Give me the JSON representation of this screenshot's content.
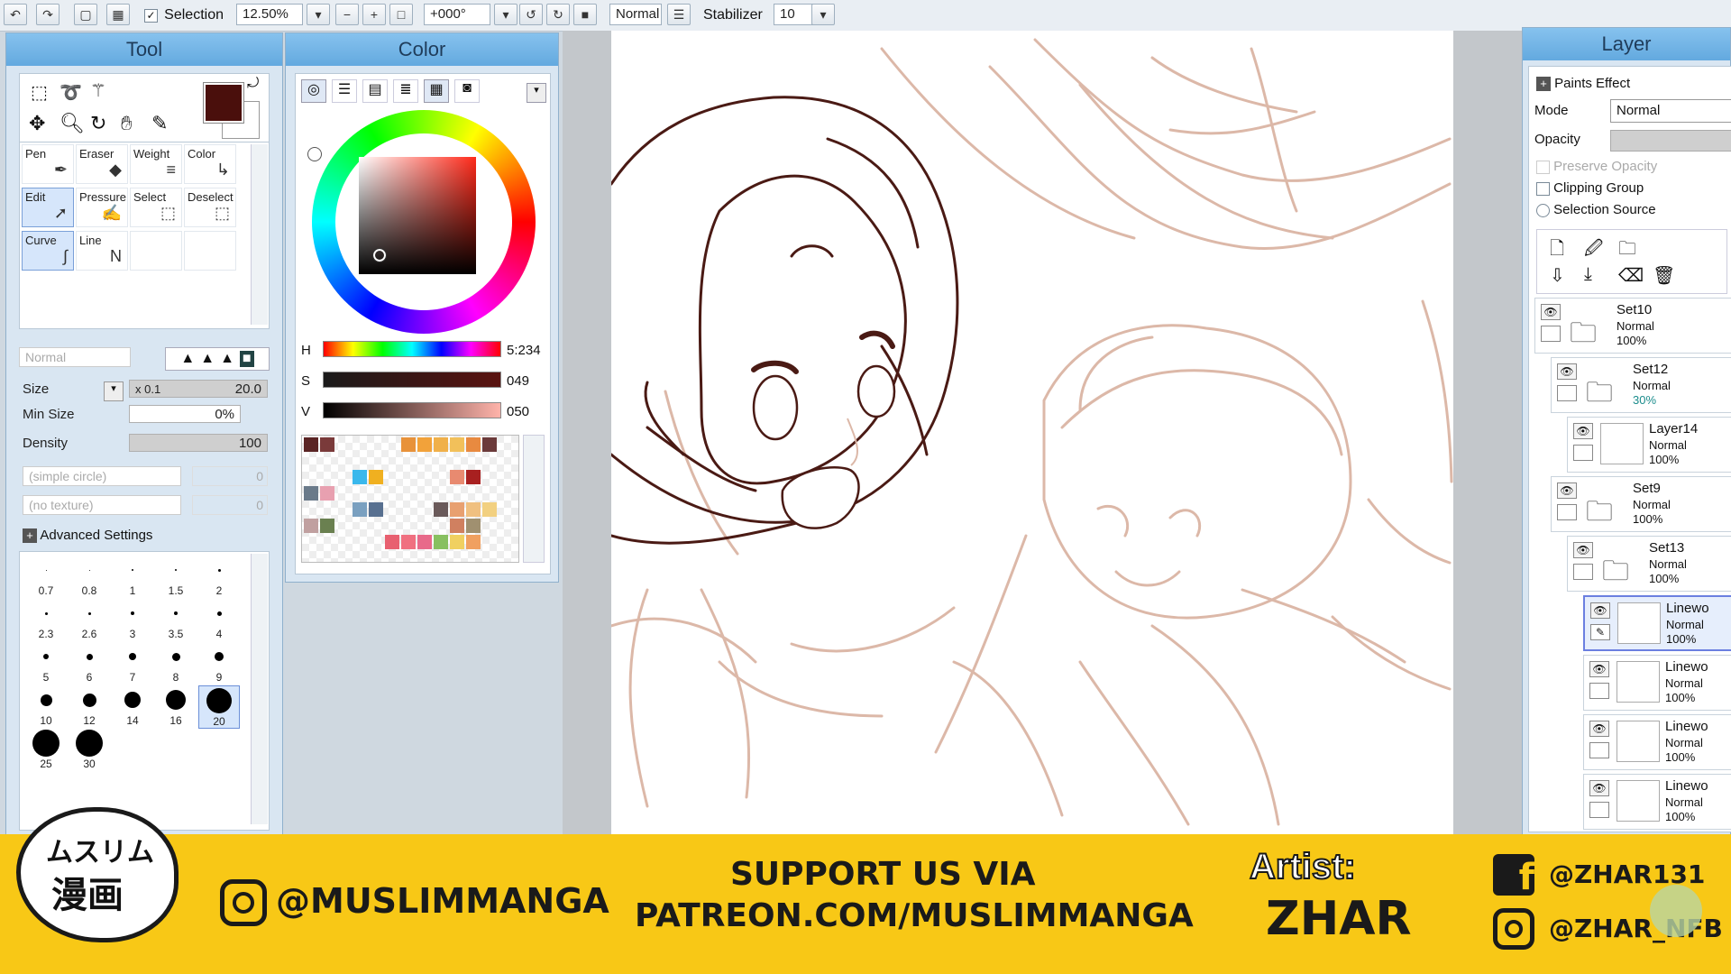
{
  "toolbar": {
    "selection_label": "Selection",
    "zoom": "12.50%",
    "rotation": "+000°",
    "blend_mode": "Normal",
    "stabilizer_label": "Stabilizer",
    "stabilizer_value": "10"
  },
  "tool_panel": {
    "title": "Tool",
    "tools": [
      {
        "label": "Pen"
      },
      {
        "label": "Eraser"
      },
      {
        "label": "Weight"
      },
      {
        "label": "Color"
      },
      {
        "label": "Edit"
      },
      {
        "label": "Pressure"
      },
      {
        "label": "Select"
      },
      {
        "label": "Deselect"
      },
      {
        "label": "Curve"
      },
      {
        "label": "Line"
      }
    ],
    "blend_mode": "Normal",
    "size_label": "Size",
    "size_mult": "x 0.1",
    "size_value": "20.0",
    "min_size_label": "Min Size",
    "min_size_value": "0%",
    "density_label": "Density",
    "density_value": "100",
    "shape_option": "(simple circle)",
    "shape_value": "0",
    "texture_option": "(no texture)",
    "texture_value": "0",
    "advanced_label": "Advanced Settings",
    "brush_sizes": [
      "0.7",
      "0.8",
      "1",
      "1.5",
      "2",
      "2.3",
      "2.6",
      "3",
      "3.5",
      "4",
      "5",
      "6",
      "7",
      "8",
      "9",
      "10",
      "12",
      "14",
      "16",
      "20",
      "25",
      "30"
    ],
    "selected_brush_size": "20"
  },
  "color_panel": {
    "title": "Color",
    "h_label": "H",
    "h_value": "5:234",
    "s_label": "S",
    "s_value": "049",
    "v_label": "V",
    "v_value": "050",
    "current_color": "#4a0f0c",
    "palette_colors": [
      "#5a2424",
      "#7a3a3a",
      "#e8923a",
      "#f2a23a",
      "#f0b04a",
      "#f2c05a",
      "#e88a40",
      "#6b3a3a",
      "#3ab8ec",
      "#f0b020",
      "#e88a70",
      "#a82020",
      "#6a7a8a",
      "#e8a0b0",
      "#7aa0c0",
      "#587090",
      "#6a5a5a",
      "#e8a070",
      "#f0c080",
      "#c0a0a0",
      "#6a8050",
      "#f2d080",
      "#d08060",
      "#a09070",
      "#e86070",
      "#f07080",
      "#e86a8a",
      "#88c060",
      "#f0d060",
      "#f0a060"
    ]
  },
  "layer_panel": {
    "title": "Layer",
    "paints_effect": "Paints Effect",
    "mode_label": "Mode",
    "mode_value": "Normal",
    "opacity_label": "Opacity",
    "preserve_opacity": "Preserve Opacity",
    "clipping_group": "Clipping Group",
    "selection_source": "Selection Source",
    "layers": [
      {
        "name": "Set10",
        "mode": "Normal",
        "opacity": "100%"
      },
      {
        "name": "Set12",
        "mode": "Normal",
        "opacity": "30%"
      },
      {
        "name": "Layer14",
        "mode": "Normal",
        "opacity": "100%"
      },
      {
        "name": "Set9",
        "mode": "Normal",
        "opacity": "100%"
      },
      {
        "name": "Set13",
        "mode": "Normal",
        "opacity": "100%"
      },
      {
        "name": "Linewo",
        "mode": "Normal",
        "opacity": "100%"
      },
      {
        "name": "Linewo",
        "mode": "Normal",
        "opacity": "100%"
      },
      {
        "name": "Linewo",
        "mode": "Normal",
        "opacity": "100%"
      },
      {
        "name": "Linewo",
        "mode": "Normal",
        "opacity": "100%"
      }
    ]
  },
  "banner": {
    "logo_text_top": "ムスリム",
    "logo_text_bottom": "漫画",
    "instagram_handle": "@MUSLIMMANGA",
    "support_line1": "SUPPORT US VIA",
    "support_line2": "PATREON.COM/MUSLIMMANGA",
    "artist_label": "Artist:",
    "artist_name": "ZHAR",
    "facebook_handle": "@ZHAR131",
    "artist_instagram": "@ZHAR_NFB"
  },
  "colors": {
    "banner_bg": "#f8c816",
    "panel_title": "#63a9df",
    "sketch_line": "#dcb8a8",
    "ink_line": "#4a1a14"
  }
}
